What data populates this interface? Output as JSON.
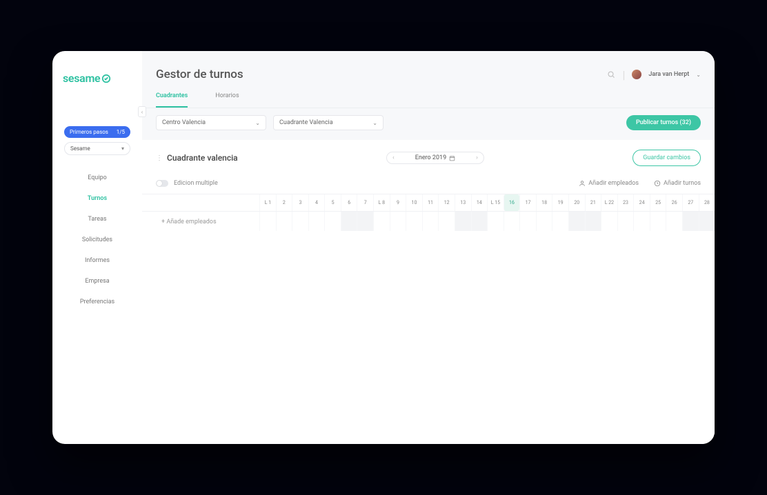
{
  "brand": "sesame",
  "sidebar": {
    "primary_pill": {
      "label": "Primeros pasos",
      "progress": "1/5"
    },
    "secondary_pill": {
      "label": "Sesame"
    },
    "items": [
      {
        "label": "Equipo"
      },
      {
        "label": "Turnos"
      },
      {
        "label": "Tareas"
      },
      {
        "label": "Solicitudes"
      },
      {
        "label": "Informes"
      },
      {
        "label": "Empresa"
      },
      {
        "label": "Preferencias"
      }
    ],
    "active_index": 1
  },
  "header": {
    "title": "Gestor de turnos",
    "user_name": "Jara van Herpt"
  },
  "tabs": {
    "items": [
      {
        "label": "Cuadrantes"
      },
      {
        "label": "Horarios"
      }
    ],
    "active_index": 0
  },
  "filters": {
    "center": "Centro Valencia",
    "schedule": "Cuadrante Valencia",
    "publish_button": "Publicar turnos (32)"
  },
  "panel": {
    "title": "Cuadrante valencia",
    "period": "Enero 2019",
    "save_button": "Guardar cambios"
  },
  "toolbar": {
    "multi_edit": "Edicion multiple",
    "add_employees": "Añadir empleados",
    "add_shifts": "Añadir turnos"
  },
  "calendar": {
    "add_row": "+ Añade empleados",
    "days": [
      "L 1",
      "2",
      "3",
      "4",
      "5",
      "6",
      "7",
      "L 8",
      "9",
      "10",
      "11",
      "12",
      "13",
      "14",
      "L 15",
      "16",
      "17",
      "18",
      "19",
      "20",
      "21",
      "L 22",
      "23",
      "24",
      "25",
      "26",
      "27",
      "28"
    ],
    "highlight_index": 15,
    "shaded_ranges": [
      [
        5,
        6
      ],
      [
        12,
        13
      ],
      [
        19,
        20
      ],
      [
        26,
        27
      ]
    ]
  }
}
